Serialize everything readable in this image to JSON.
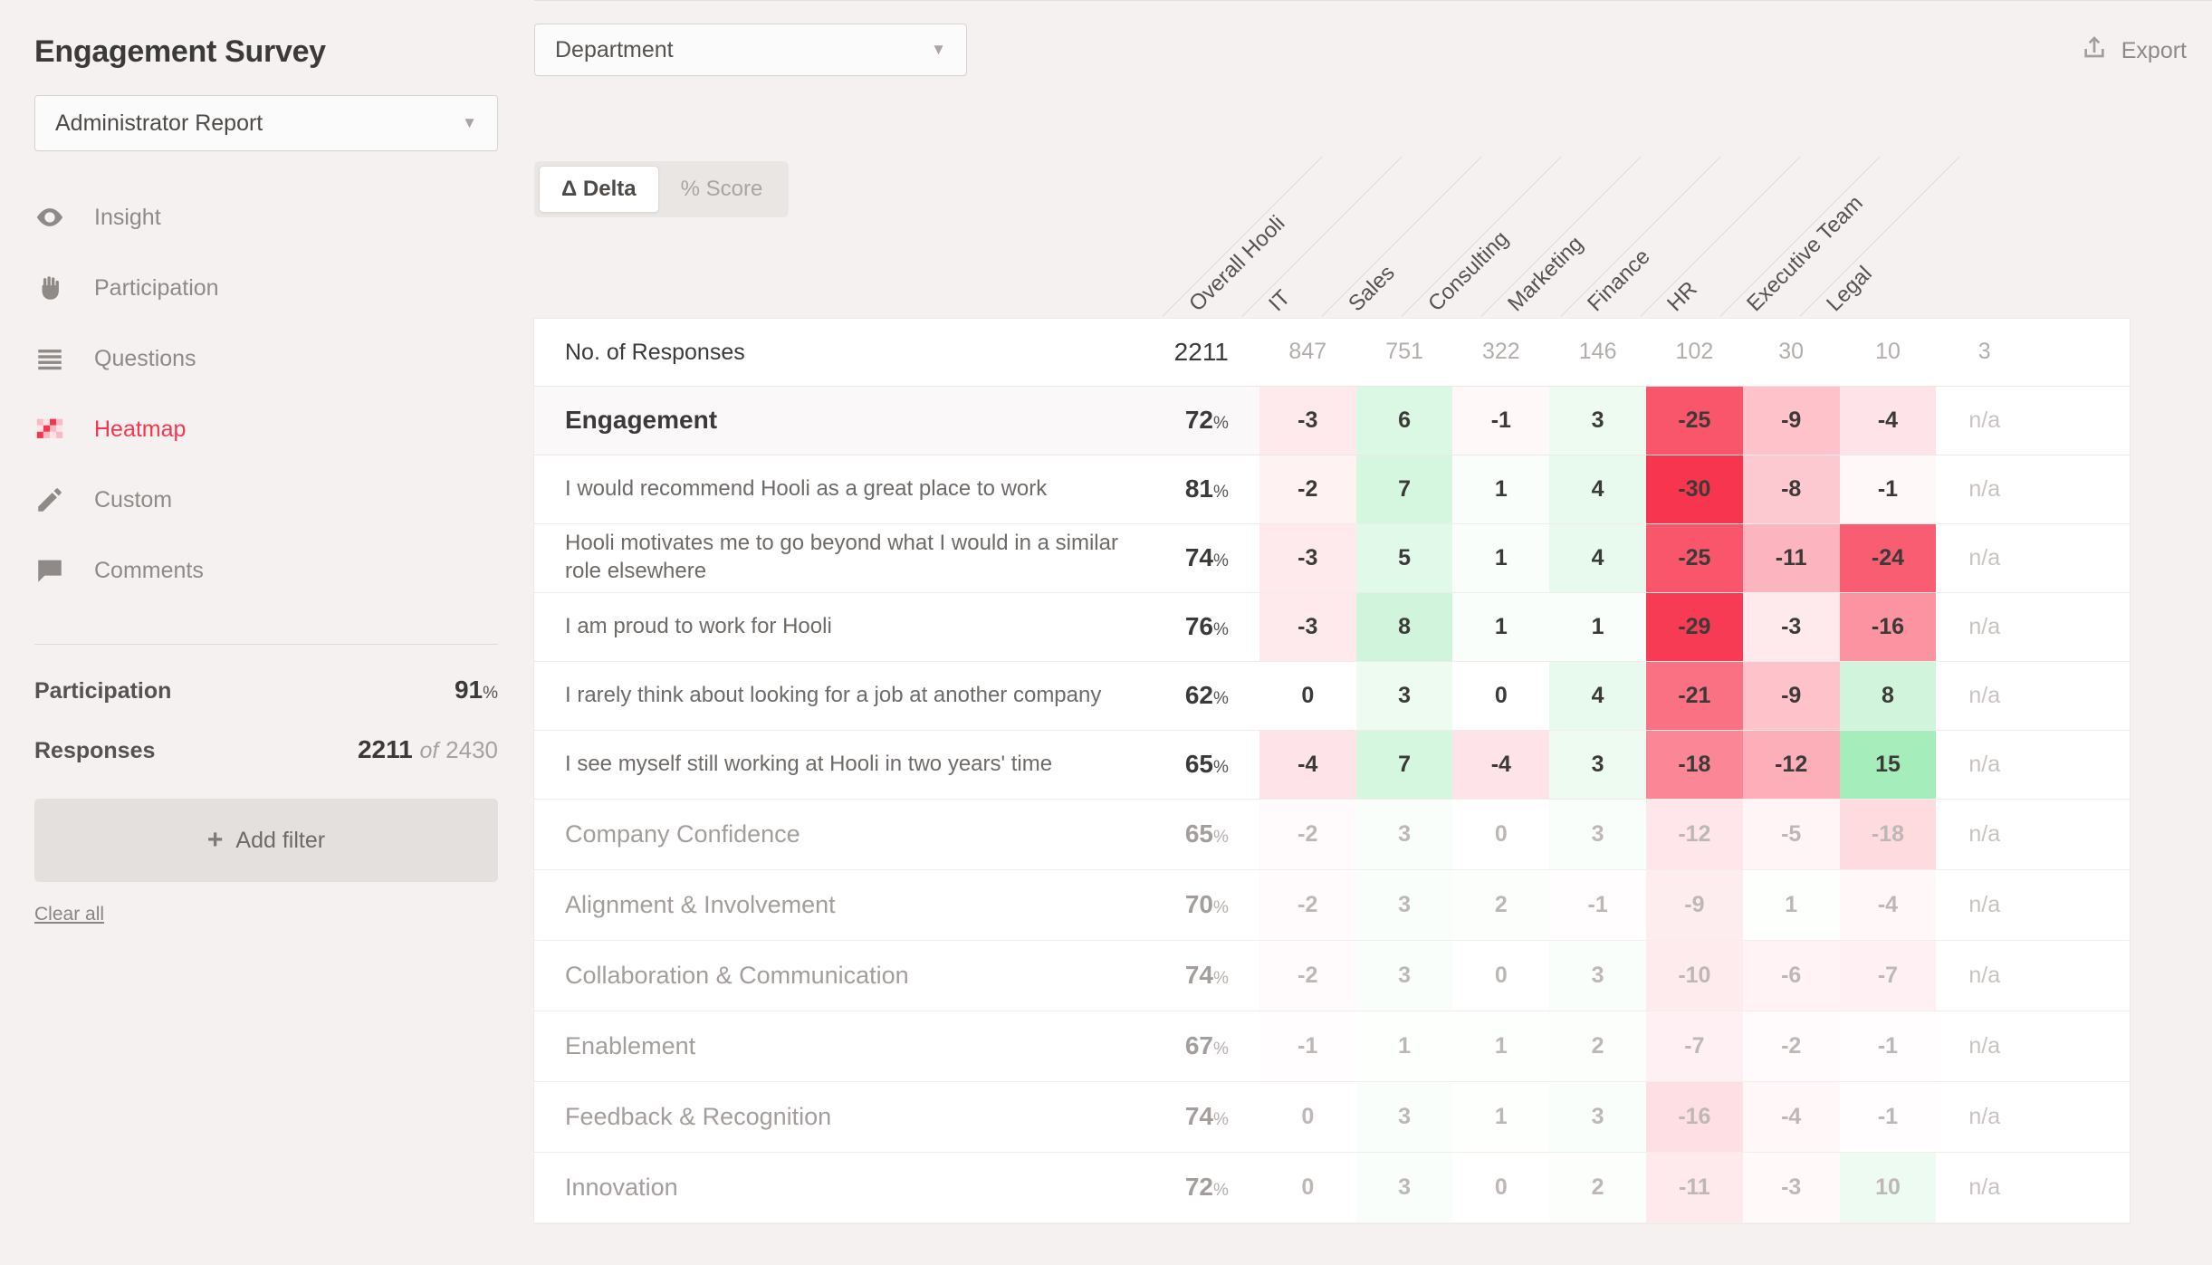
{
  "sidebar": {
    "title": "Engagement Survey",
    "report_select": {
      "value": "Administrator Report",
      "caret": "▼"
    },
    "nav": [
      {
        "label": "Insight",
        "icon": "eye-icon",
        "active": false
      },
      {
        "label": "Participation",
        "icon": "hand-icon",
        "active": false
      },
      {
        "label": "Questions",
        "icon": "list-icon",
        "active": false
      },
      {
        "label": "Heatmap",
        "icon": "heatmap-icon",
        "active": true
      },
      {
        "label": "Custom",
        "icon": "pencil-icon",
        "active": false
      },
      {
        "label": "Comments",
        "icon": "comment-icon",
        "active": false
      }
    ],
    "stats": {
      "participation_label": "Participation",
      "participation_value": "91",
      "participation_unit": "%",
      "responses_label": "Responses",
      "responses_value": "2211",
      "responses_of": "of",
      "responses_total": "2430"
    },
    "add_filter_label": "Add filter",
    "add_filter_plus": "+",
    "clear_all_label": "Clear all"
  },
  "toolbar": {
    "department_select": {
      "value": "Department",
      "caret": "▼"
    },
    "export_label": "Export",
    "toggle": {
      "delta_label": "Δ Delta",
      "score_label": "% Score",
      "active": "delta"
    }
  },
  "colors": {
    "accent": "#f8354f",
    "background": "#f4f1f0",
    "panel": "#ffffff",
    "positive": "#4ddb7a",
    "negative": "#f8354f"
  },
  "chart_data": {
    "type": "heatmap",
    "title": "Engagement Survey Heatmap",
    "columns": [
      "Overall Hooli",
      "IT",
      "Sales",
      "Consulting",
      "Marketing",
      "Finance",
      "HR",
      "Executive Team",
      "Legal"
    ],
    "score_column_header": "",
    "rows": [
      {
        "label": "No. of Responses",
        "score": "2211",
        "unit": "",
        "kind": "responses",
        "dim": false,
        "values": [
          "847",
          "751",
          "322",
          "146",
          "102",
          "30",
          "10",
          "3",
          ""
        ]
      },
      {
        "label": "Engagement",
        "score": "72",
        "unit": "%",
        "kind": "section",
        "dim": false,
        "values": [
          "-3",
          "6",
          "-1",
          "3",
          "-25",
          "-9",
          "-4",
          "n/a",
          ""
        ]
      },
      {
        "label": "I would recommend Hooli as a great place to work",
        "score": "81",
        "unit": "%",
        "kind": "question",
        "dim": false,
        "values": [
          "-2",
          "7",
          "1",
          "4",
          "-30",
          "-8",
          "-1",
          "n/a",
          ""
        ]
      },
      {
        "label": "Hooli motivates me to go beyond what I would in a similar role elsewhere",
        "score": "74",
        "unit": "%",
        "kind": "question",
        "dim": false,
        "values": [
          "-3",
          "5",
          "1",
          "4",
          "-25",
          "-11",
          "-24",
          "n/a",
          ""
        ]
      },
      {
        "label": "I am proud to work for Hooli",
        "score": "76",
        "unit": "%",
        "kind": "question",
        "dim": false,
        "values": [
          "-3",
          "8",
          "1",
          "1",
          "-29",
          "-3",
          "-16",
          "n/a",
          ""
        ]
      },
      {
        "label": "I rarely think about looking for a job at another company",
        "score": "62",
        "unit": "%",
        "kind": "question",
        "dim": false,
        "values": [
          "0",
          "3",
          "0",
          "4",
          "-21",
          "-9",
          "8",
          "n/a",
          ""
        ]
      },
      {
        "label": "I see myself still working at Hooli in two years' time",
        "score": "65",
        "unit": "%",
        "kind": "question",
        "dim": false,
        "values": [
          "-4",
          "7",
          "-4",
          "3",
          "-18",
          "-12",
          "15",
          "n/a",
          ""
        ]
      },
      {
        "label": "Company Confidence",
        "score": "65",
        "unit": "%",
        "kind": "category",
        "dim": true,
        "values": [
          "-2",
          "3",
          "0",
          "3",
          "-12",
          "-5",
          "-18",
          "n/a",
          ""
        ]
      },
      {
        "label": "Alignment & Involvement",
        "score": "70",
        "unit": "%",
        "kind": "category",
        "dim": true,
        "values": [
          "-2",
          "3",
          "2",
          "-1",
          "-9",
          "1",
          "-4",
          "n/a",
          ""
        ]
      },
      {
        "label": "Collaboration & Communication",
        "score": "74",
        "unit": "%",
        "kind": "category",
        "dim": true,
        "values": [
          "-2",
          "3",
          "0",
          "3",
          "-10",
          "-6",
          "-7",
          "n/a",
          ""
        ]
      },
      {
        "label": "Enablement",
        "score": "67",
        "unit": "%",
        "kind": "category",
        "dim": true,
        "values": [
          "-1",
          "1",
          "1",
          "2",
          "-7",
          "-2",
          "-1",
          "n/a",
          ""
        ]
      },
      {
        "label": "Feedback & Recognition",
        "score": "74",
        "unit": "%",
        "kind": "category",
        "dim": true,
        "values": [
          "0",
          "3",
          "1",
          "3",
          "-16",
          "-4",
          "-1",
          "n/a",
          ""
        ]
      },
      {
        "label": "Innovation",
        "score": "72",
        "unit": "%",
        "kind": "category",
        "dim": true,
        "values": [
          "0",
          "3",
          "0",
          "2",
          "-11",
          "-3",
          "10",
          "n/a",
          ""
        ]
      }
    ]
  }
}
